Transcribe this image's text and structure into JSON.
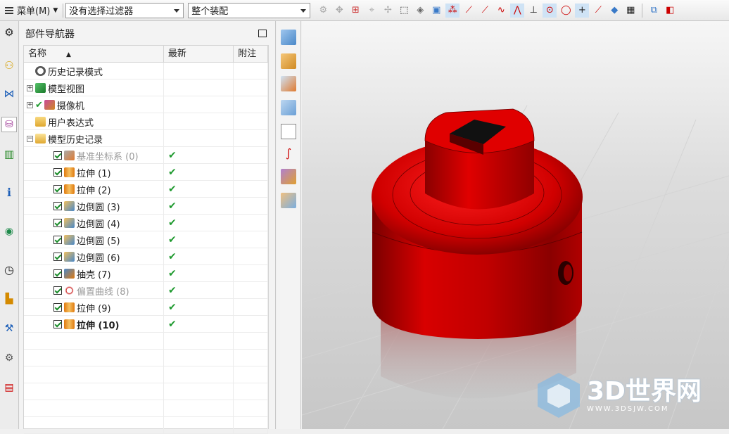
{
  "toolbar": {
    "menu_label": "菜单(M)",
    "filter_value": "没有选择过滤器",
    "assembly_value": "整个装配"
  },
  "navigator": {
    "title": "部件导航器",
    "columns": [
      "名称",
      "最新",
      "附注"
    ],
    "rows": [
      {
        "label": "历史记录模式",
        "icon": "clock-icon",
        "level": 0,
        "expander": "",
        "checkbox": false,
        "latest": "",
        "style": "normal"
      },
      {
        "label": "模型视图",
        "icon": "model-views-icon",
        "level": 0,
        "expander": "+",
        "checkbox": false,
        "latest": "",
        "style": "normal"
      },
      {
        "label": "摄像机",
        "icon": "camera-icon",
        "level": 0,
        "expander": "+",
        "checkbox": false,
        "latest": "",
        "style": "normal",
        "checkmark": true
      },
      {
        "label": "用户表达式",
        "icon": "folder-icon",
        "level": 0,
        "expander": "",
        "checkbox": false,
        "latest": "",
        "style": "normal"
      },
      {
        "label": "模型历史记录",
        "icon": "folder-open-icon",
        "level": 0,
        "expander": "−",
        "checkbox": false,
        "latest": "",
        "style": "normal"
      },
      {
        "label": "基准坐标系 (0)",
        "icon": "datum-csys-icon",
        "level": 1,
        "expander": "",
        "checkbox": true,
        "latest": "✔",
        "style": "gray"
      },
      {
        "label": "拉伸 (1)",
        "icon": "extrude-icon",
        "level": 1,
        "expander": "",
        "checkbox": true,
        "latest": "✔",
        "style": "normal"
      },
      {
        "label": "拉伸 (2)",
        "icon": "extrude-icon",
        "level": 1,
        "expander": "",
        "checkbox": true,
        "latest": "✔",
        "style": "normal"
      },
      {
        "label": "边倒圆 (3)",
        "icon": "edge-blend-icon",
        "level": 1,
        "expander": "",
        "checkbox": true,
        "latest": "✔",
        "style": "normal"
      },
      {
        "label": "边倒圆 (4)",
        "icon": "edge-blend-icon",
        "level": 1,
        "expander": "",
        "checkbox": true,
        "latest": "✔",
        "style": "normal"
      },
      {
        "label": "边倒圆 (5)",
        "icon": "edge-blend-icon",
        "level": 1,
        "expander": "",
        "checkbox": true,
        "latest": "✔",
        "style": "normal"
      },
      {
        "label": "边倒圆 (6)",
        "icon": "edge-blend-icon",
        "level": 1,
        "expander": "",
        "checkbox": true,
        "latest": "✔",
        "style": "normal"
      },
      {
        "label": "抽壳 (7)",
        "icon": "shell-icon",
        "level": 1,
        "expander": "",
        "checkbox": true,
        "latest": "✔",
        "style": "normal"
      },
      {
        "label": "偏置曲线 (8)",
        "icon": "offset-curve-icon",
        "level": 1,
        "expander": "",
        "checkbox": true,
        "latest": "✔",
        "style": "gray"
      },
      {
        "label": "拉伸 (9)",
        "icon": "extrude-icon",
        "level": 1,
        "expander": "",
        "checkbox": true,
        "latest": "✔",
        "style": "normal"
      },
      {
        "label": "拉伸 (10)",
        "icon": "extrude-icon",
        "level": 1,
        "expander": "",
        "checkbox": true,
        "latest": "✔",
        "style": "bold"
      }
    ]
  },
  "watermark": {
    "brand": "3D世界网",
    "url": "WWW.3DSJW.COM"
  },
  "colors": {
    "model_red": "#d40000",
    "check_green": "#1f9a2f"
  }
}
